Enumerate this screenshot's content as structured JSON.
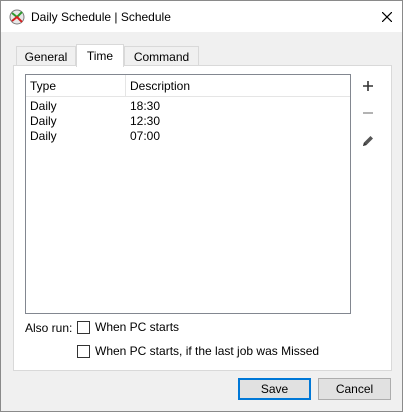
{
  "window": {
    "title": "Daily Schedule | Schedule"
  },
  "tabs": [
    {
      "label": "General",
      "active": false
    },
    {
      "label": "Time",
      "active": true
    },
    {
      "label": "Command",
      "active": false
    }
  ],
  "list": {
    "columns": [
      "Type",
      "Description"
    ],
    "rows": [
      {
        "type": "Daily",
        "description": "18:30"
      },
      {
        "type": "Daily",
        "description": "12:30"
      },
      {
        "type": "Daily",
        "description": "07:00"
      }
    ]
  },
  "side_buttons": {
    "add_icon": "plus-icon",
    "remove_icon": "minus-icon",
    "edit_icon": "pencil-icon"
  },
  "also_run": {
    "label": "Also run:",
    "options": [
      {
        "label": "When PC starts",
        "checked": false
      },
      {
        "label": "When PC starts, if the last job was Missed",
        "checked": false
      }
    ]
  },
  "buttons": {
    "save": "Save",
    "cancel": "Cancel"
  },
  "colors": {
    "accent": "#0078d7",
    "window_bg": "#f0f0f0",
    "panel_bg": "#ffffff"
  }
}
